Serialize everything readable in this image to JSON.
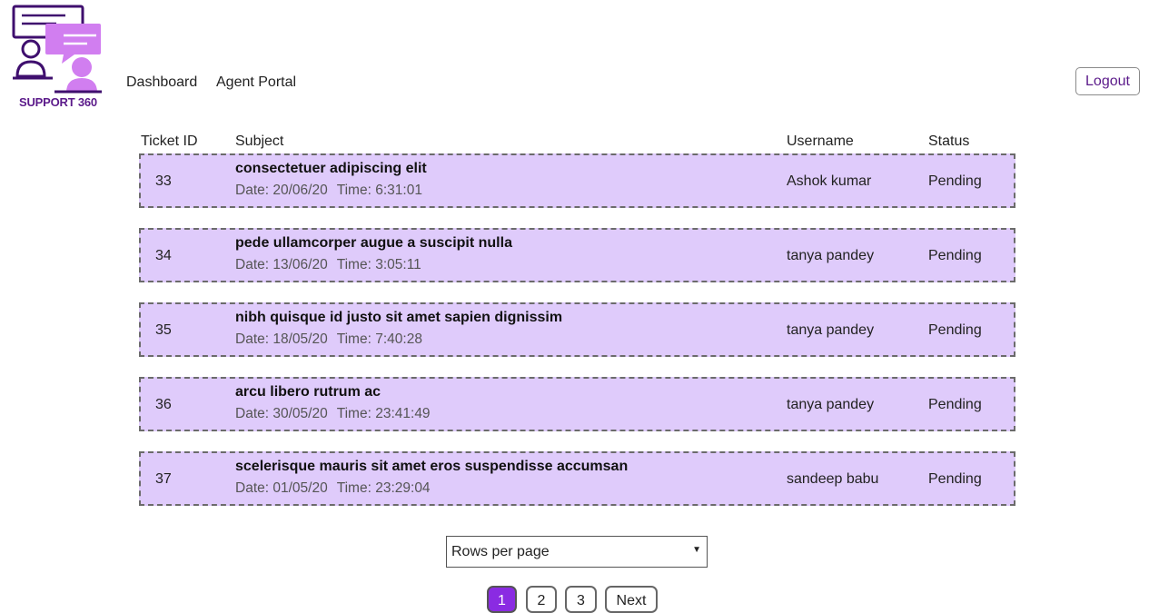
{
  "brand": {
    "name": "SUPPORT 360",
    "logo_icon": "support-chat-agents-icon",
    "accent": "#d17ef0",
    "dark": "#3f0f6e"
  },
  "nav": {
    "dashboard": "Dashboard",
    "agent_portal": "Agent Portal",
    "logout": "Logout"
  },
  "table": {
    "headers": {
      "id": "Ticket ID",
      "subject": "Subject",
      "username": "Username",
      "status": "Status"
    },
    "row_bg": "#dfcbfb",
    "date_prefix": "Date:",
    "time_prefix": "Time:",
    "rows": [
      {
        "id": "33",
        "subject": "consectetuer adipiscing elit",
        "date": "20/06/20",
        "time": "6:31:01",
        "username": "Ashok kumar",
        "status": "Pending"
      },
      {
        "id": "34",
        "subject": "pede ullamcorper augue a suscipit nulla",
        "date": "13/06/20",
        "time": "3:05:11",
        "username": "tanya pandey",
        "status": "Pending"
      },
      {
        "id": "35",
        "subject": "nibh quisque id justo sit amet sapien dignissim",
        "date": "18/05/20",
        "time": "7:40:28",
        "username": "tanya pandey",
        "status": "Pending"
      },
      {
        "id": "36",
        "subject": "arcu libero rutrum ac",
        "date": "30/05/20",
        "time": "23:41:49",
        "username": "tanya pandey",
        "status": "Pending"
      },
      {
        "id": "37",
        "subject": "scelerisque mauris sit amet eros suspendisse accumsan",
        "date": "01/05/20",
        "time": "23:29:04",
        "username": "sandeep babu",
        "status": "Pending"
      }
    ]
  },
  "rows_per_page": {
    "label": "Rows per page"
  },
  "pagination": {
    "pages": [
      "1",
      "2",
      "3"
    ],
    "active": "1",
    "next": "Next",
    "active_color": "#8a2be2"
  }
}
